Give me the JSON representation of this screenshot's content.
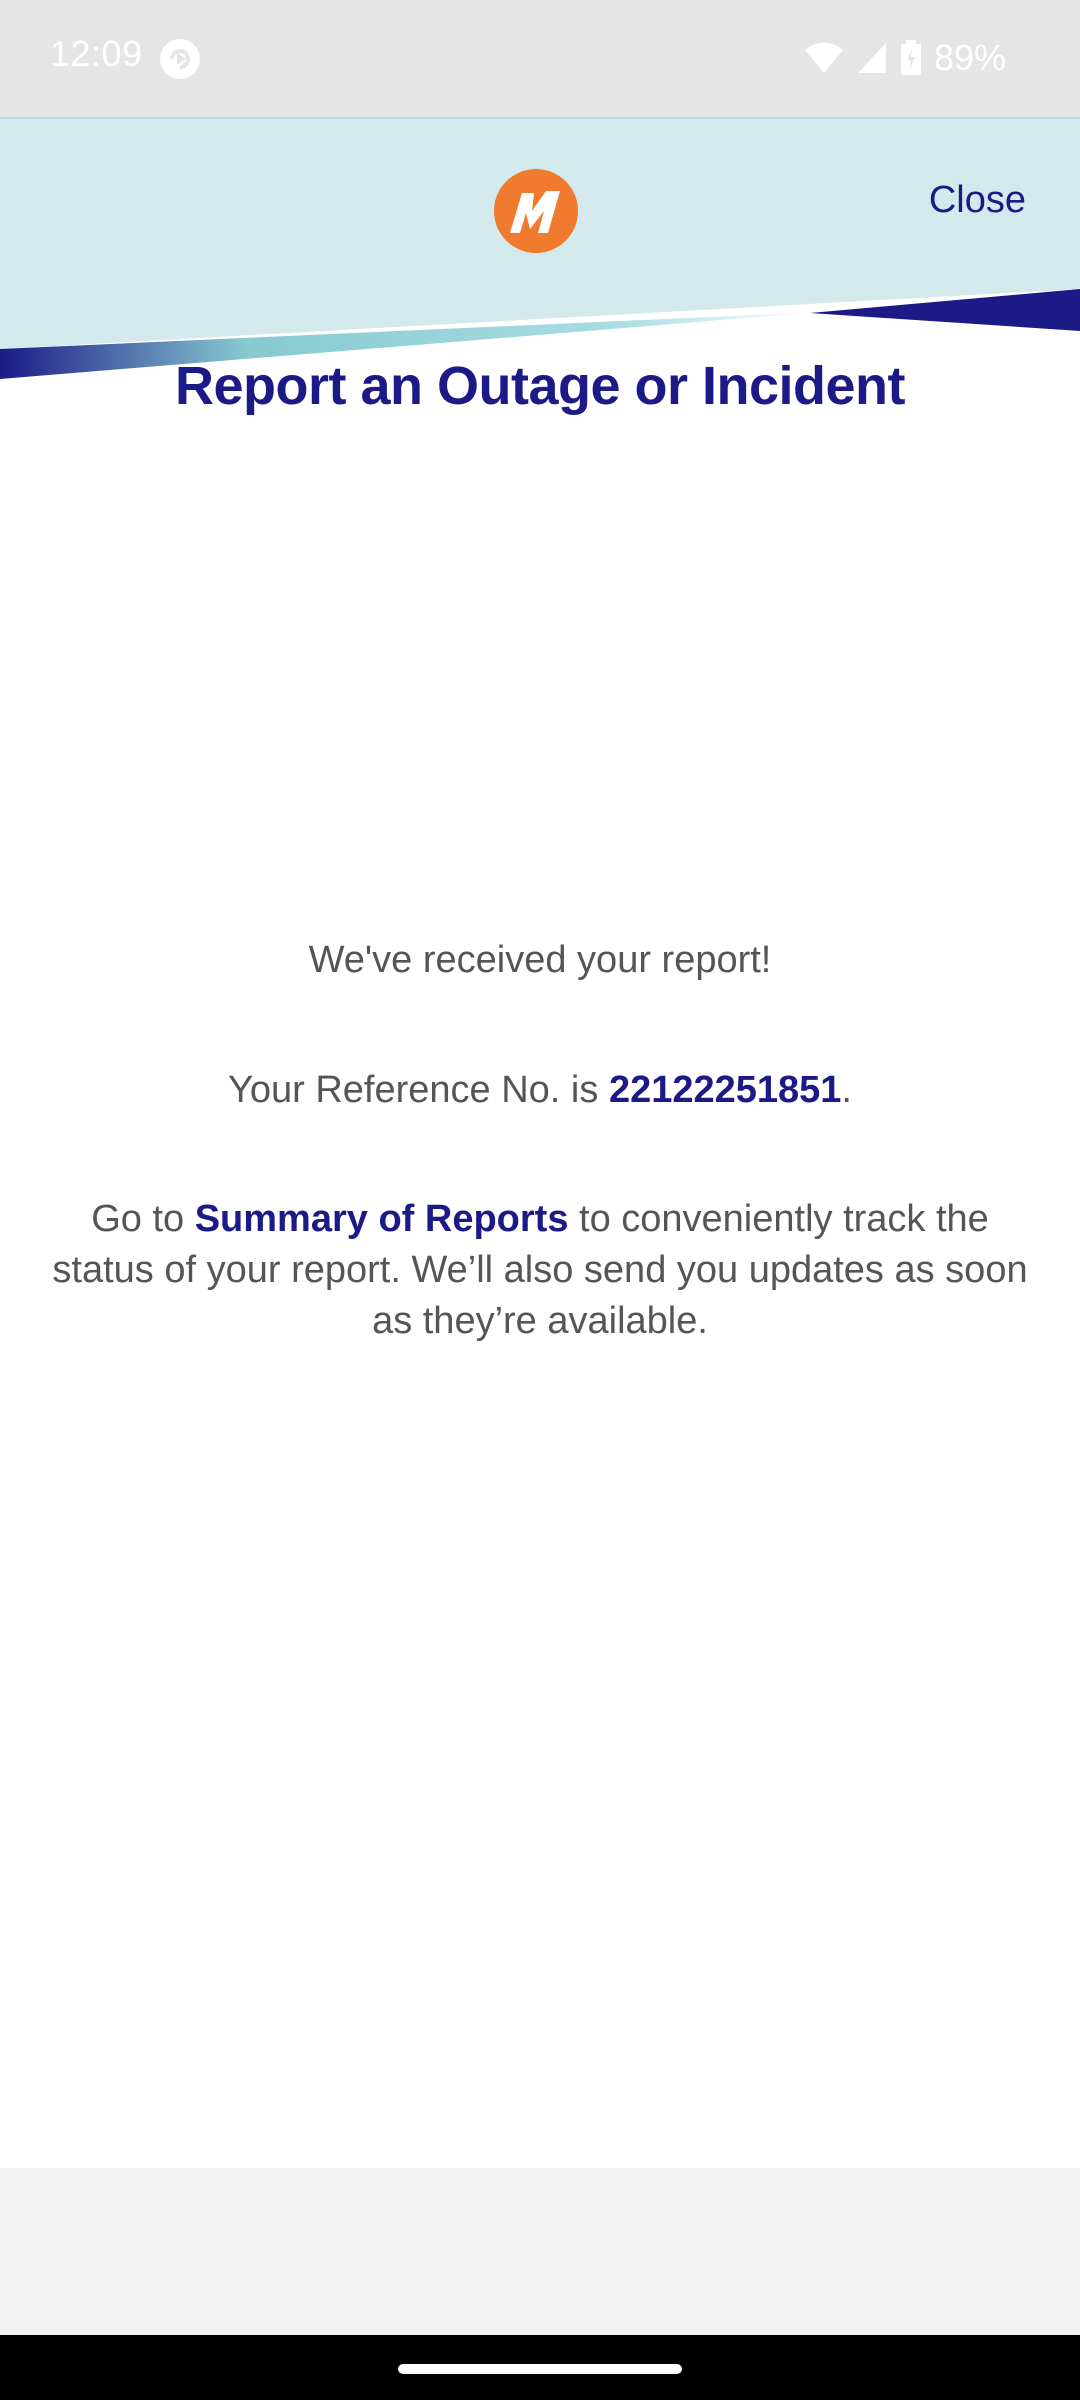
{
  "status_bar": {
    "time": "12:09",
    "battery": "89%",
    "icons": [
      "app-notification-icon",
      "wifi-icon",
      "signal-icon",
      "battery-icon"
    ]
  },
  "header": {
    "close_label": "Close",
    "logo_icon": "meralco-logo-icon",
    "colors": {
      "banner_bg": "#d4e9ec",
      "accent_navy": "#1b1a86",
      "accent_teal": "#86c9d2",
      "logo_orange": "#f07a2e"
    }
  },
  "page": {
    "title": "Report an Outage or Incident"
  },
  "confirmation": {
    "received": "We've received your report!",
    "reference_prefix": "Your Reference No. is ",
    "reference_number": "22122251851",
    "reference_suffix": ".",
    "summary_prefix": "Go to ",
    "summary_link": "Summary of Reports",
    "summary_suffix": " to conveniently track the status of your report. We’ll also send you updates as soon as they’re available."
  }
}
